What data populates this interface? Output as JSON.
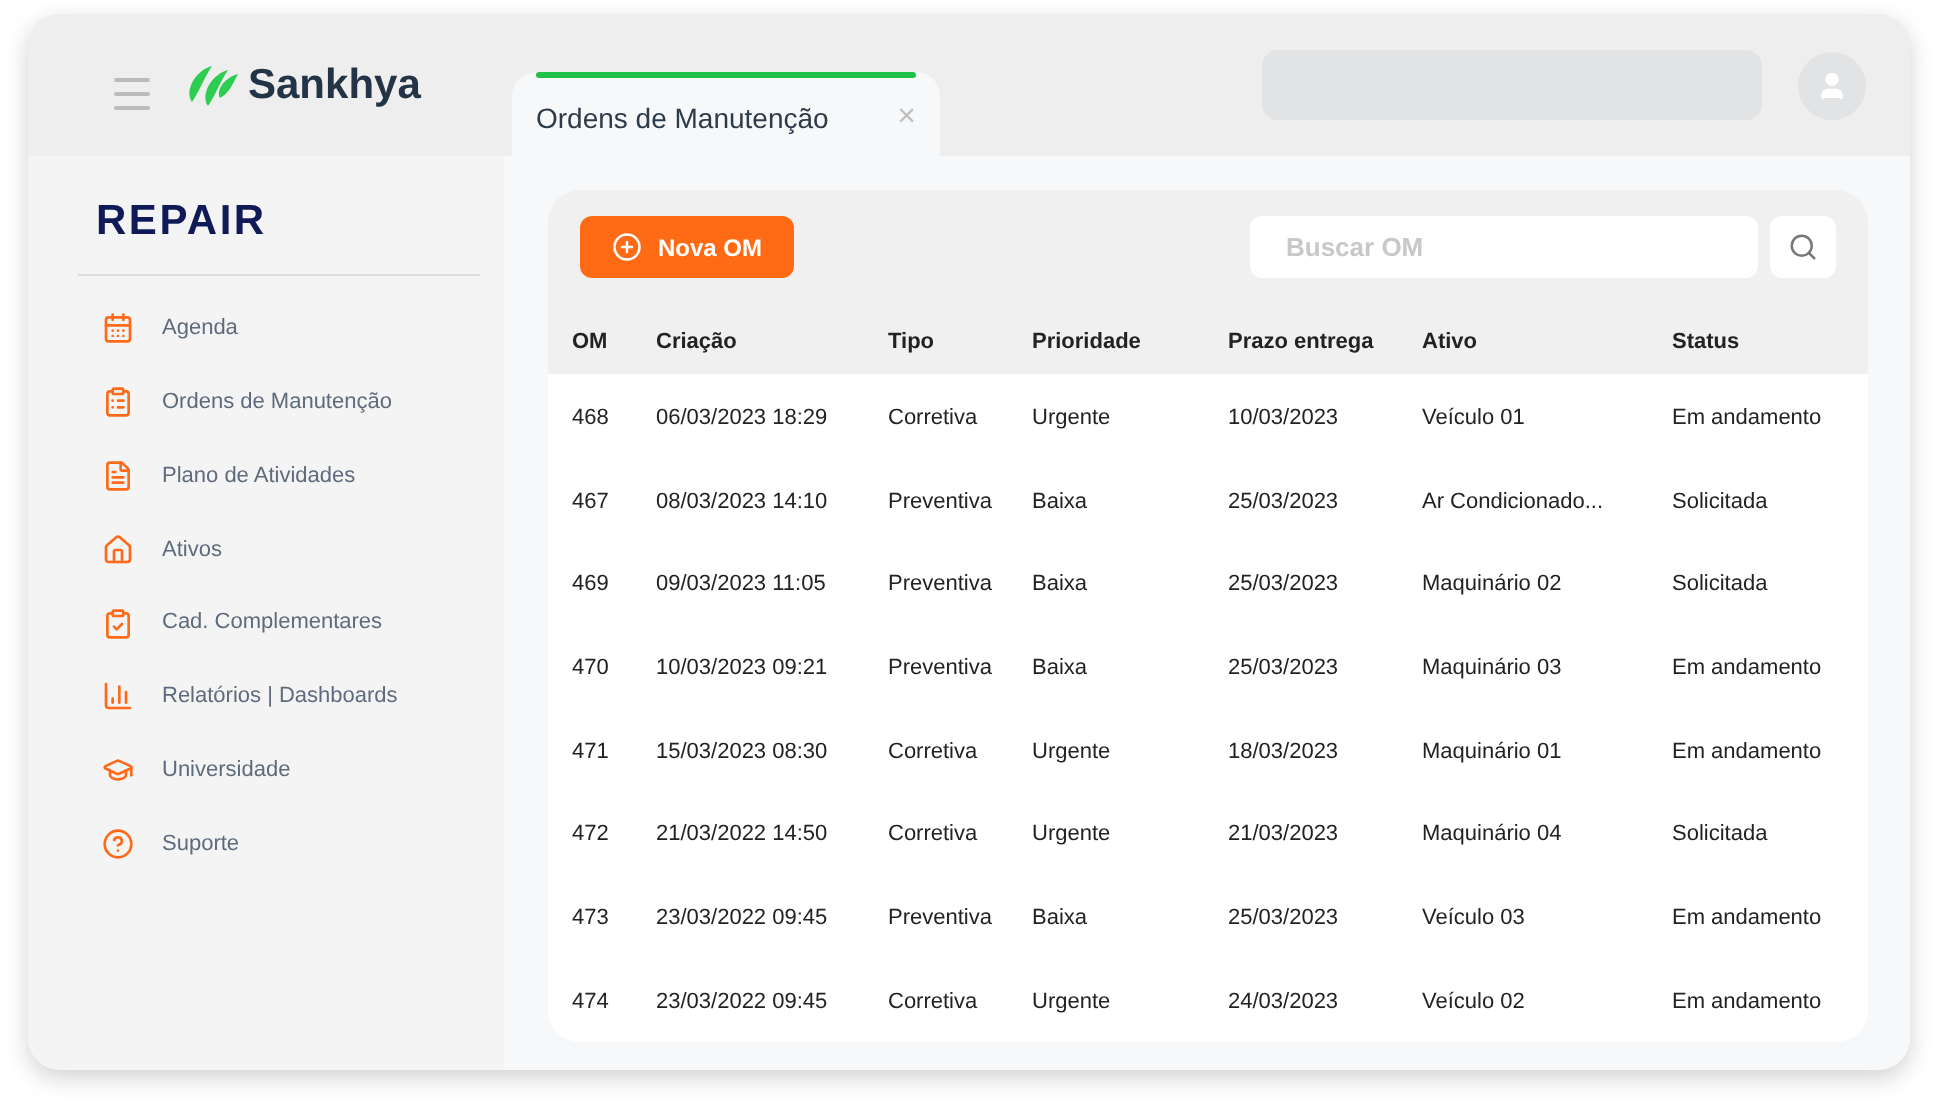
{
  "header": {
    "brand": "Sankhya"
  },
  "tabs": [
    {
      "label": "Ordens de Manutenção",
      "selected": true,
      "close": "×"
    }
  ],
  "sidebar": {
    "logo": "REPAIR",
    "items": [
      {
        "label": "Agenda",
        "kind": "calendar"
      },
      {
        "label": "Ordens de Manutenção",
        "kind": "clipboard"
      },
      {
        "label": "Plano de Atividades",
        "kind": "document"
      },
      {
        "label": "Ativos",
        "kind": "home"
      },
      {
        "label": "Cad. Complementares",
        "kind": "checklist"
      },
      {
        "label": "Relatórios | Dashboards",
        "kind": "chart"
      },
      {
        "label": "Universidade",
        "kind": "graduation"
      },
      {
        "label": "Suporte",
        "kind": "help"
      }
    ]
  },
  "toolbar": {
    "new_button": "Nova OM",
    "search": {
      "placeholder": "Buscar OM"
    }
  },
  "table": {
    "columns": [
      "OM",
      "Criação",
      "Tipo",
      "Prioridade",
      "Prazo entrega",
      "Ativo",
      "Status"
    ],
    "rows": [
      [
        "468",
        "06/03/2023 18:29",
        "Corretiva",
        "Urgente",
        "10/03/2023",
        "Veículo 01",
        "Em andamento"
      ],
      [
        "467",
        "08/03/2023 14:10",
        "Preventiva",
        "Baixa",
        "25/03/2023",
        "Ar Condicionado...",
        "Solicitada"
      ],
      [
        "469",
        "09/03/2023 11:05",
        "Preventiva",
        "Baixa",
        "25/03/2023",
        "Maquinário 02",
        "Solicitada"
      ],
      [
        "470",
        "10/03/2023 09:21",
        "Preventiva",
        "Baixa",
        "25/03/2023",
        "Maquinário 03",
        "Em andamento"
      ],
      [
        "471",
        "15/03/2023 08:30",
        "Corretiva",
        "Urgente",
        "18/03/2023",
        "Maquinário 01",
        "Em andamento"
      ],
      [
        "472",
        "21/03/2022 14:50",
        "Corretiva",
        "Urgente",
        "21/03/2023",
        "Maquinário 04",
        "Solicitada"
      ],
      [
        "473",
        "23/03/2022 09:45",
        "Preventiva",
        "Baixa",
        "25/03/2023",
        "Veículo 03",
        "Em andamento"
      ],
      [
        "474",
        "23/03/2022 09:45",
        "Corretiva",
        "Urgente",
        "24/03/2023",
        "Veículo 02",
        "Em andamento"
      ]
    ]
  }
}
